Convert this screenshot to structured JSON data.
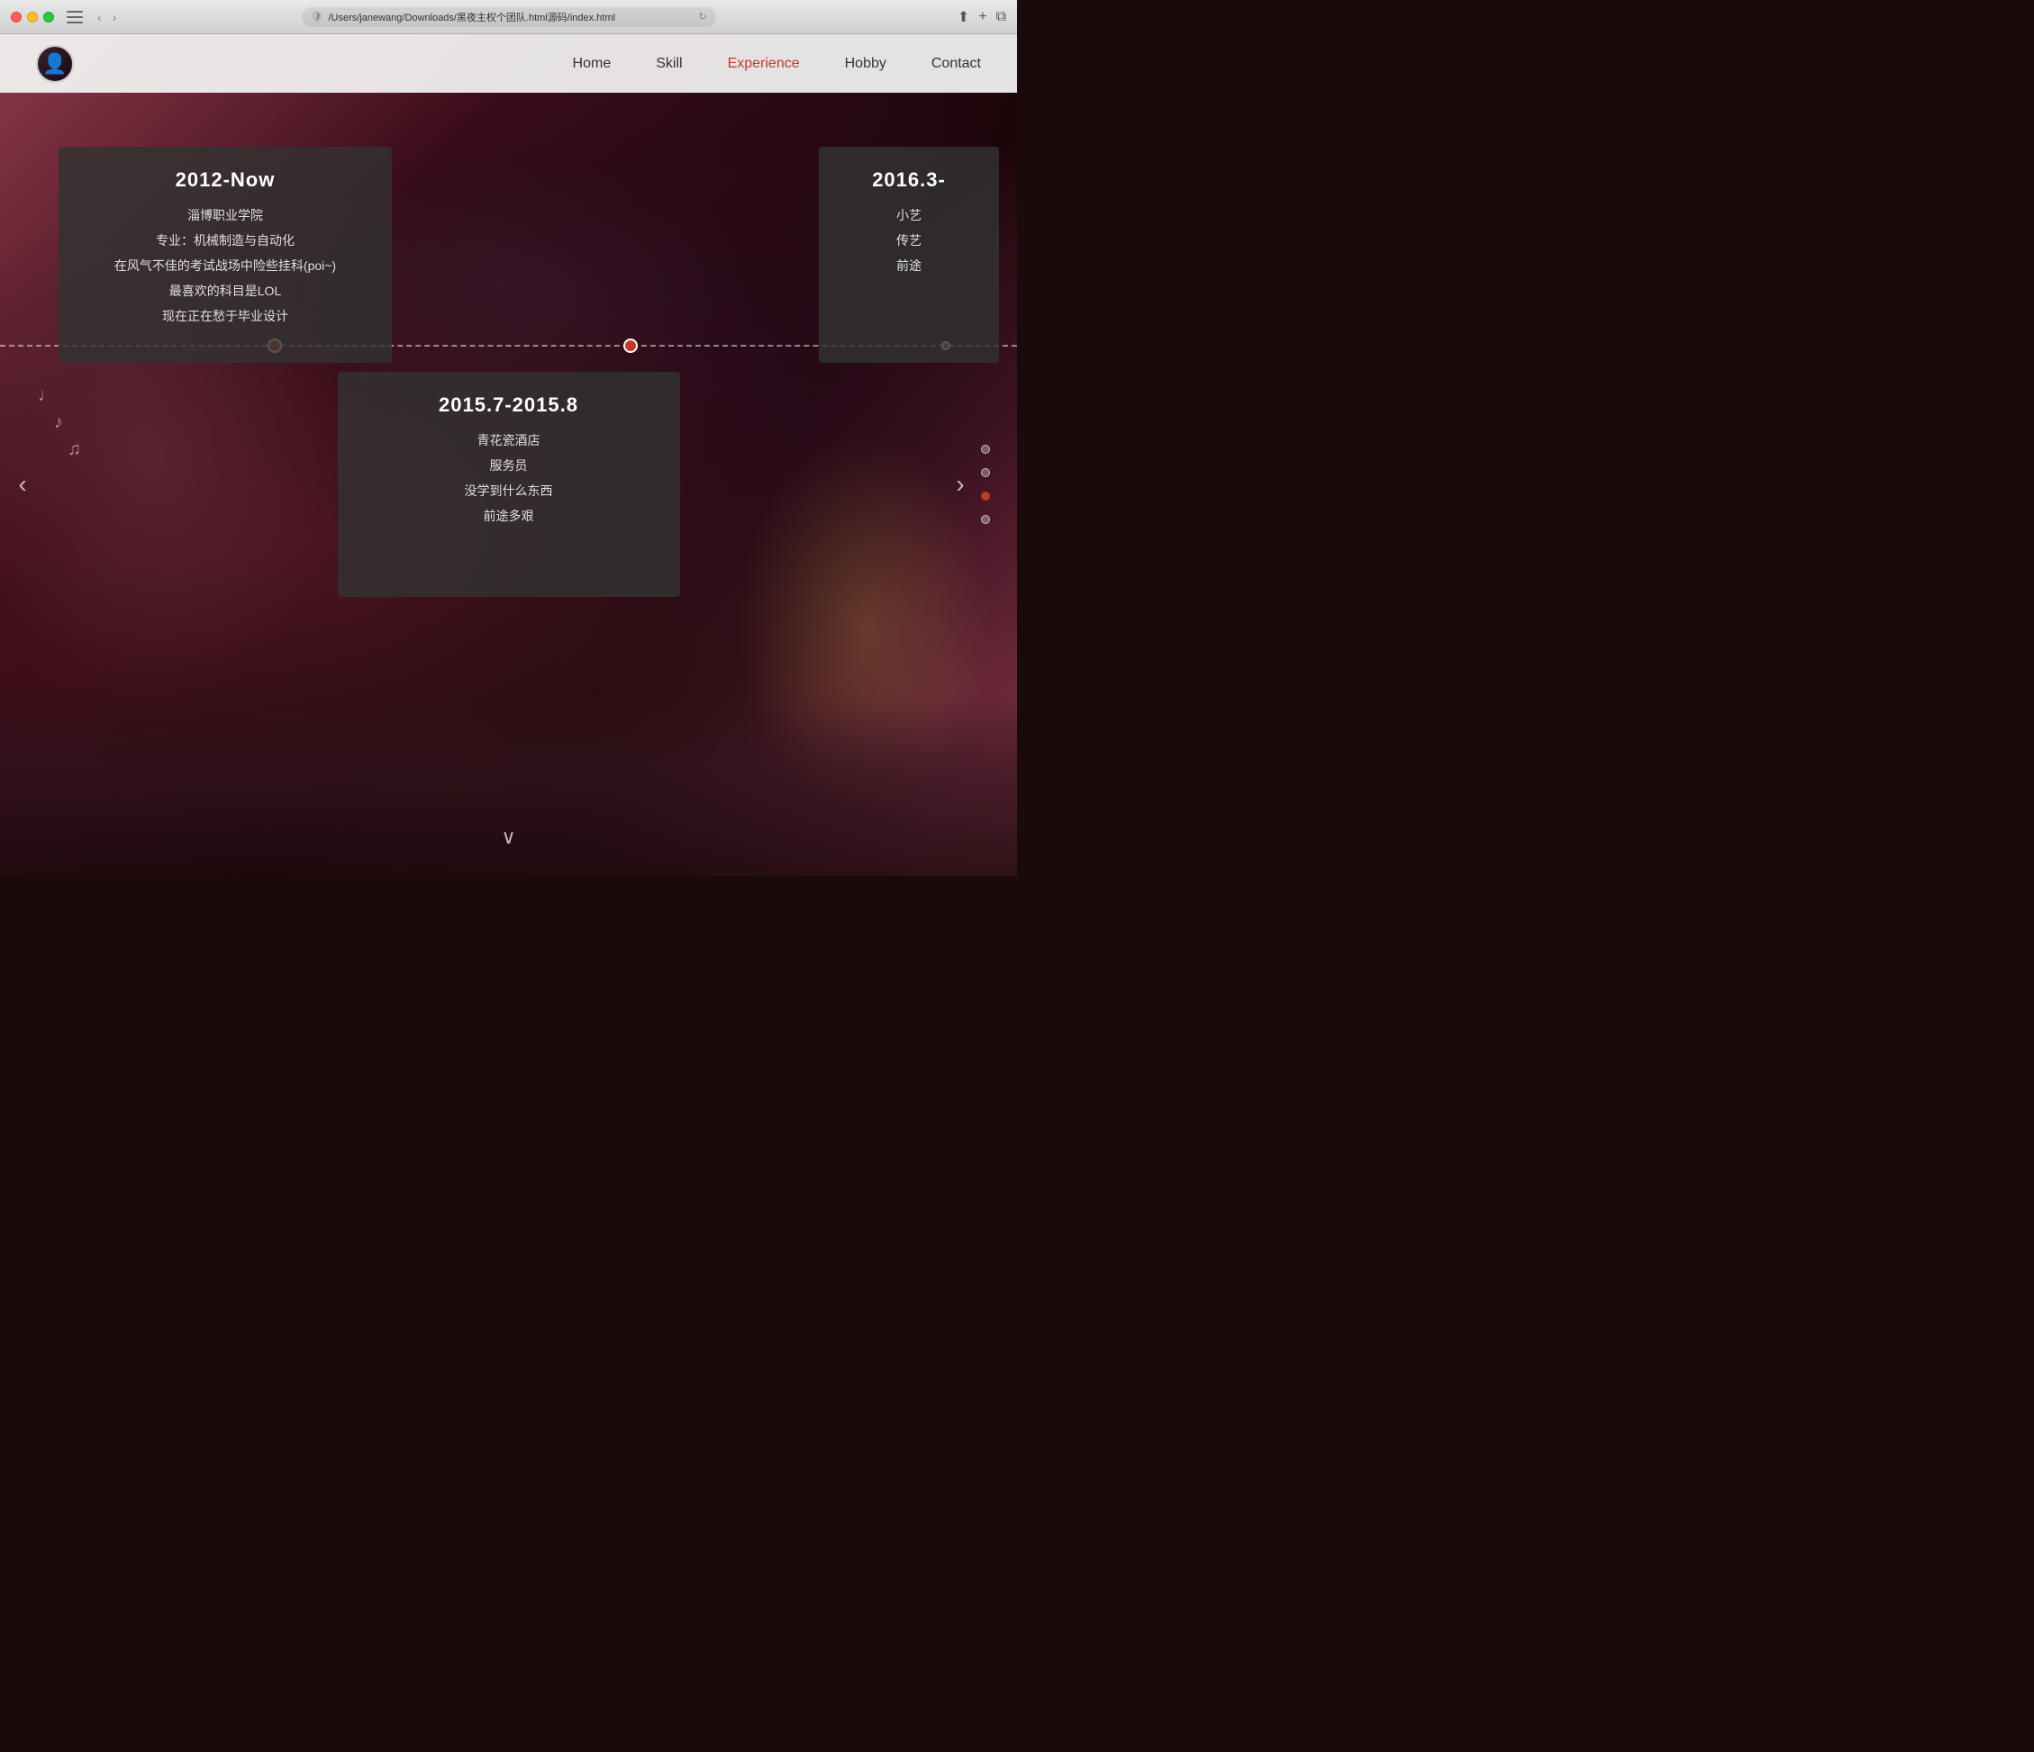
{
  "browser": {
    "url": "/Users/janewang/Downloads/黑夜主权个团队.html源码/index.html",
    "reload_icon": "↻"
  },
  "navbar": {
    "avatar_emoji": "👤",
    "links": [
      {
        "id": "home",
        "label": "Home",
        "active": false
      },
      {
        "id": "skill",
        "label": "Skill",
        "active": false
      },
      {
        "id": "experience",
        "label": "Experience",
        "active": true
      },
      {
        "id": "hobby",
        "label": "Hobby",
        "active": false
      },
      {
        "id": "contact",
        "label": "Contact",
        "active": false
      }
    ]
  },
  "timeline": {
    "card_left": {
      "title": "2012-Now",
      "lines": [
        "淄博职业学院",
        "专业：机械制造与自动化",
        "在风气不佳的考试战场中险些挂科(poi~)",
        "最喜欢的科目是LOL",
        "现在正在愁于毕业设计"
      ]
    },
    "card_right": {
      "title": "2016.3-",
      "lines": [
        "小艺",
        "传艺",
        "前途"
      ]
    },
    "card_bottom": {
      "title": "2015.7-2015.8",
      "lines": [
        "青花瓷酒店",
        "服务员",
        "没学到什么东西",
        "前途多艰"
      ]
    }
  },
  "pagination": {
    "dots": [
      {
        "active": false
      },
      {
        "active": false
      },
      {
        "active": true
      },
      {
        "active": false
      }
    ]
  },
  "arrows": {
    "left": "‹",
    "right": "›"
  },
  "scroll_hint": "∨"
}
